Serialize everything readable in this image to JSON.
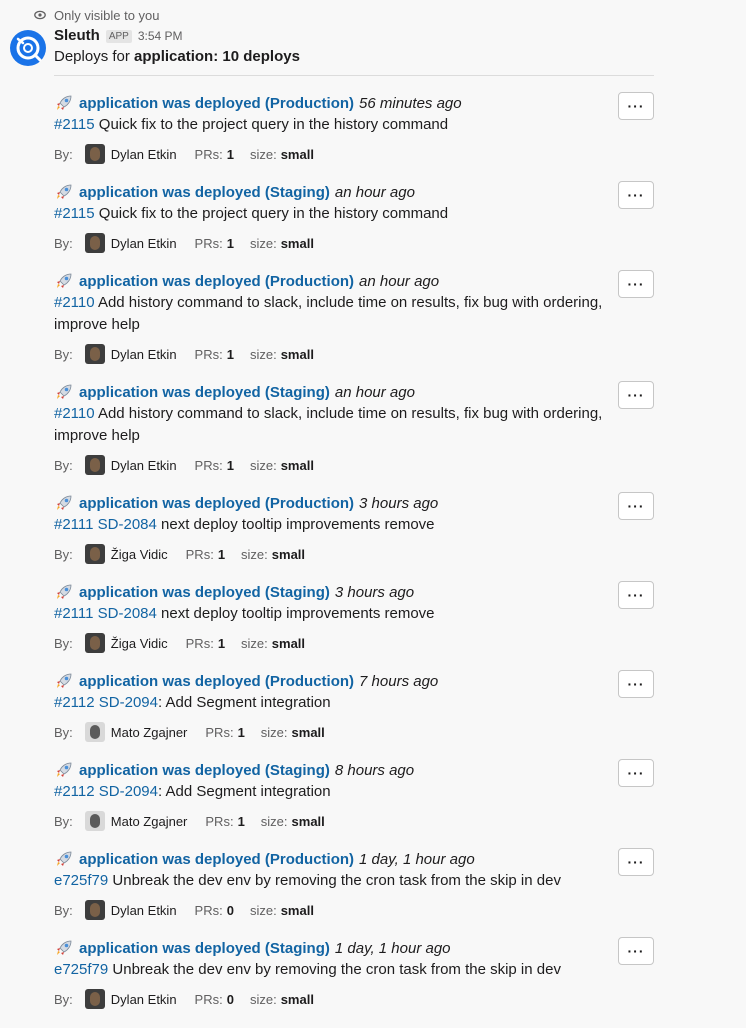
{
  "notice": "Only visible to you",
  "header": {
    "sender": "Sleuth",
    "badge": "APP",
    "time": "3:54 PM"
  },
  "summary": {
    "prefix": "Deploys for ",
    "app": "application",
    "sep": ": ",
    "count": "10 deploys"
  },
  "labels": {
    "by": "By:",
    "prs": "PRs:",
    "size": "size:",
    "more": "···"
  },
  "deploys": [
    {
      "title": "application was deployed (Production)",
      "ago": "56 minutes ago",
      "ref": "#2115",
      "ticket": "",
      "text": " Quick fix to the project query in the history command",
      "user": "Dylan Etkin",
      "prs": "1",
      "size": "small"
    },
    {
      "title": "application was deployed (Staging)",
      "ago": "an hour ago",
      "ref": "#2115",
      "ticket": "",
      "text": " Quick fix to the project query in the history command",
      "user": "Dylan Etkin",
      "prs": "1",
      "size": "small"
    },
    {
      "title": "application was deployed (Production)",
      "ago": "an hour ago",
      "ref": "#2110",
      "ticket": "",
      "text": " Add history command to slack, include time on results, fix bug with ordering, improve help",
      "user": "Dylan Etkin",
      "prs": "1",
      "size": "small"
    },
    {
      "title": "application was deployed (Staging)",
      "ago": "an hour ago",
      "ref": "#2110",
      "ticket": "",
      "text": " Add history command to slack, include time on results, fix bug with ordering, improve help",
      "user": "Dylan Etkin",
      "prs": "1",
      "size": "small"
    },
    {
      "title": "application was deployed (Production)",
      "ago": "3 hours ago",
      "ref": "#2111",
      "ticket": " SD-2084",
      "text": " next deploy tooltip improvements remove",
      "user": "Žiga Vidic",
      "prs": "1",
      "size": "small"
    },
    {
      "title": "application was deployed (Staging)",
      "ago": "3 hours ago",
      "ref": "#2111",
      "ticket": " SD-2084",
      "text": " next deploy tooltip improvements remove",
      "user": "Žiga Vidic",
      "prs": "1",
      "size": "small"
    },
    {
      "title": "application was deployed (Production)",
      "ago": "7 hours ago",
      "ref": "#2112",
      "ticket": " SD-2094",
      "text": ": Add Segment integration",
      "user": "Mato Zgajner",
      "prs": "1",
      "size": "small"
    },
    {
      "title": "application was deployed (Staging)",
      "ago": "8 hours ago",
      "ref": "#2112",
      "ticket": " SD-2094",
      "text": ": Add Segment integration",
      "user": "Mato Zgajner",
      "prs": "1",
      "size": "small"
    },
    {
      "title": "application was deployed (Production)",
      "ago": "1 day, 1 hour ago",
      "ref": "e725f79",
      "ticket": "",
      "text": " Unbreak the dev env by removing the cron task from the skip in dev",
      "user": "Dylan Etkin",
      "prs": "0",
      "size": "small"
    },
    {
      "title": "application was deployed (Staging)",
      "ago": "1 day, 1 hour ago",
      "ref": "e725f79",
      "ticket": "",
      "text": " Unbreak the dev env by removing the cron task from the skip in dev",
      "user": "Dylan Etkin",
      "prs": "0",
      "size": "small"
    }
  ]
}
